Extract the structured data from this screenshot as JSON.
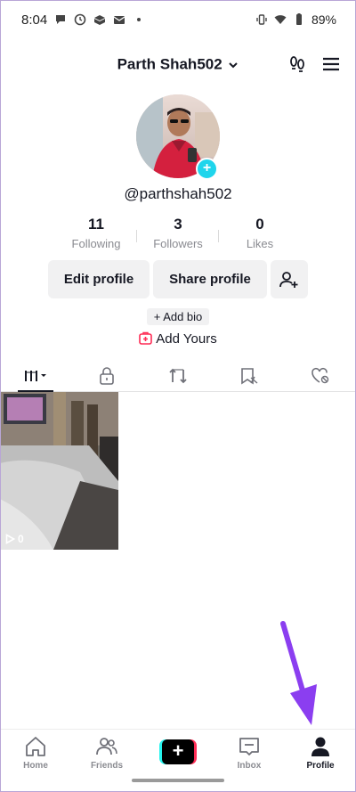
{
  "status_bar": {
    "time": "8:04",
    "battery": "89%",
    "icons": [
      "chat-icon",
      "clock-icon",
      "boxes-icon",
      "mail-icon",
      "dot-icon",
      "vibrate-icon",
      "wifi-icon",
      "battery-icon"
    ]
  },
  "header": {
    "username": "Parth Shah502",
    "icons": [
      "chevron-down-icon",
      "footprint-icon",
      "menu-icon"
    ]
  },
  "profile": {
    "handle": "@parthshah502",
    "avatar_add": "+"
  },
  "stats": [
    {
      "value": "11",
      "label": "Following"
    },
    {
      "value": "3",
      "label": "Followers"
    },
    {
      "value": "0",
      "label": "Likes"
    }
  ],
  "actions": {
    "edit": "Edit profile",
    "share": "Share profile"
  },
  "bio": {
    "add_bio": "+ Add bio",
    "add_yours": "Add Yours"
  },
  "tabs": [
    "videos-grid-icon",
    "lock-icon",
    "repost-icon",
    "saved-icon",
    "liked-icon"
  ],
  "videos": [
    {
      "views": "0"
    }
  ],
  "nav": {
    "home": "Home",
    "friends": "Friends",
    "create": "+",
    "inbox": "Inbox",
    "profile": "Profile"
  },
  "colors": {
    "accent_cyan": "#20d5ec",
    "accent_red": "#fe2c55",
    "annotation_arrow": "#8b3ef0"
  }
}
